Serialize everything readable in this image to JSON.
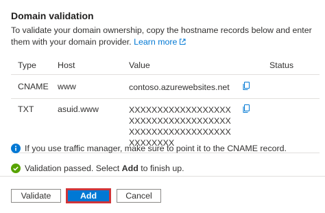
{
  "panel": {
    "title": "Domain validation",
    "description": "To validate your domain ownership, copy the hostname records below and enter them with your domain provider.",
    "learn_more": "Learn more"
  },
  "table": {
    "headers": {
      "type": "Type",
      "host": "Host",
      "value": "Value",
      "status": "Status"
    },
    "rows": [
      {
        "type": "CNAME",
        "host": "www",
        "value": "contoso.azurewebsites.net",
        "status": ""
      },
      {
        "type": "TXT",
        "host": "asuid.www",
        "value": "XXXXXXXXXXXXXXXXXXXXXXXXXXXXXXXXXXXXXXXXXXXXXXXXXXXXXXXXXXXXXX",
        "status": ""
      }
    ]
  },
  "messages": {
    "info": "If you use traffic manager, make sure to point it to the CNAME record.",
    "success_prefix": "Validation passed. Select ",
    "success_bold": "Add",
    "success_suffix": " to finish up."
  },
  "buttons": {
    "validate": "Validate",
    "add": "Add",
    "cancel": "Cancel"
  },
  "icons": {
    "info": "info-icon",
    "success": "checkmark-circle-icon",
    "copy": "copy-icon",
    "external": "open-external-icon"
  },
  "colors": {
    "accent": "#0078d4",
    "success": "#57a300",
    "focus_outline": "#d13438"
  }
}
